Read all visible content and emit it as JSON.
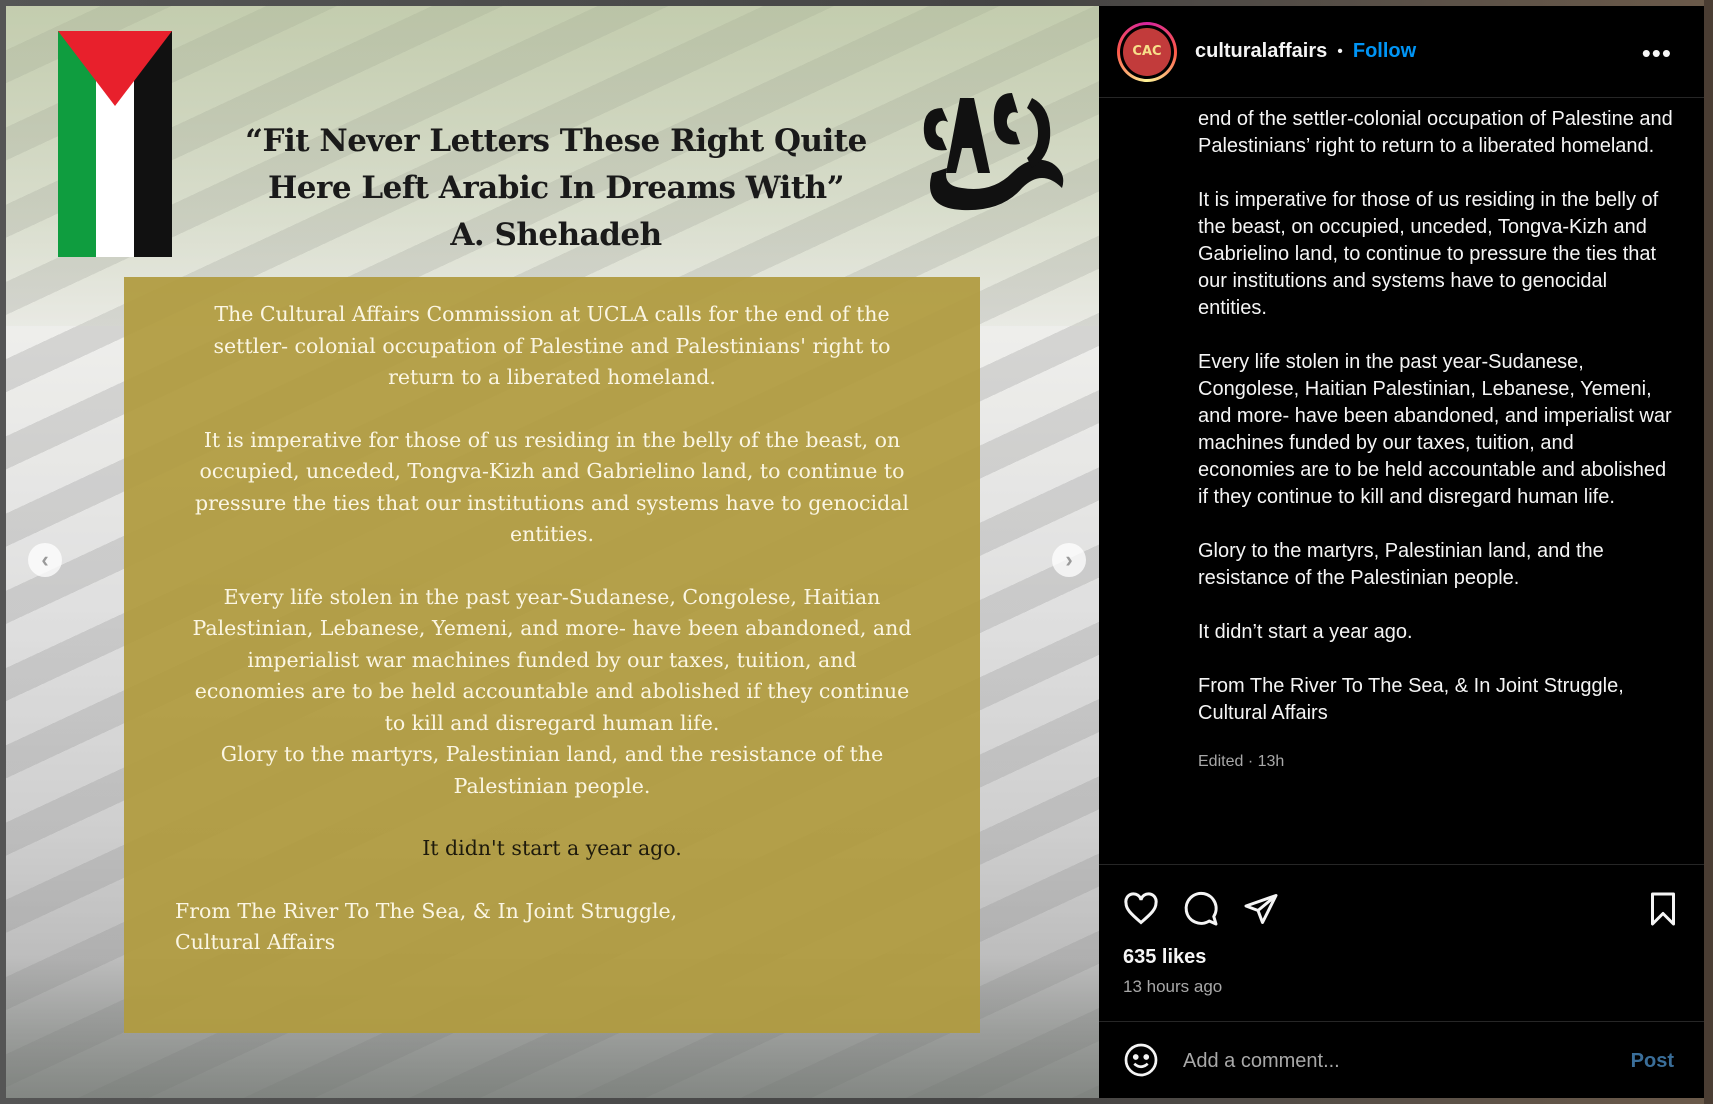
{
  "post": {
    "username": "culturalaffairs",
    "separator": "•",
    "follow_label": "Follow",
    "more_label": "•••",
    "avatar_text": "CAC"
  },
  "media": {
    "quote_line1": "“Fit Never Letters These Right Quite",
    "quote_line2": "Here Left Arabic In Dreams With”",
    "quote_author": "A. Shehadeh",
    "logo_alt": "CAC",
    "box": {
      "p1": "The Cultural Affairs Commission at UCLA calls for the end of the settler- colonial occupation of Palestine and Palestinians' right to return to a liberated homeland.",
      "p2": "It is imperative for those of us residing in the belly of the beast, on occupied, unceded, Tongva-Kizh and Gabrielino land, to continue to pressure the ties that our institutions and systems have to genocidal entities.",
      "p3": "Every life stolen in the past year-Sudanese, Congolese, Haitian Palestinian, Lebanese, Yemeni, and more- have been abandoned, and imperialist war machines funded by our taxes, tuition, and economies are to be held accountable and abolished if they continue to kill and disregard human life.",
      "p4": "Glory to the martyrs, Palestinian land, and the resistance of the Palestinian people.",
      "p5": "It didn't start a year ago.",
      "sign1": "From The River To The Sea,  & In Joint Struggle,",
      "sign2": "Cultural Affairs"
    },
    "prev_label": "‹",
    "next_label": "›"
  },
  "caption": {
    "p1": "The Cultural Affairs Commission at UCLA calls for the end of the settler-colonial occupation of Palestine and Palestinians’ right to return to a liberated homeland.",
    "p2": "It is imperative for those of us residing in the belly of the beast, on occupied, unceded, Tongva-Kizh and Gabrielino land, to continue to pressure the ties that our institutions and systems have to genocidal entities.",
    "p3": "Every life stolen in the past year-Sudanese, Congolese, Haitian Palestinian, Lebanese, Yemeni, and more- have been abandoned, and imperialist war machines funded by our taxes, tuition, and economies are to be held accountable and abolished if they continue to kill and disregard human life.",
    "p4": "Glory to the martyrs, Palestinian land, and the resistance of the Palestinian people.",
    "p5": "It didn’t start a year ago.",
    "p6a": "From The River To The Sea, & In Joint Struggle,",
    "p6b": "Cultural Affairs",
    "edited": "Edited · 13h"
  },
  "stats": {
    "likes": "635 likes",
    "time_ago": "13 hours ago"
  },
  "comment": {
    "placeholder": "Add a comment...",
    "post_label": "Post"
  },
  "icons": [
    "heart-icon",
    "comment-icon",
    "share-icon",
    "bookmark-icon",
    "emoji-icon",
    "more-icon",
    "chevron-left-icon",
    "chevron-right-icon"
  ],
  "colors": {
    "follow": "#0095f6",
    "panel_bg": "#000000",
    "box_gold": "#b09b3e",
    "flag_red": "#e8202c",
    "flag_green": "#0f9d3f"
  }
}
